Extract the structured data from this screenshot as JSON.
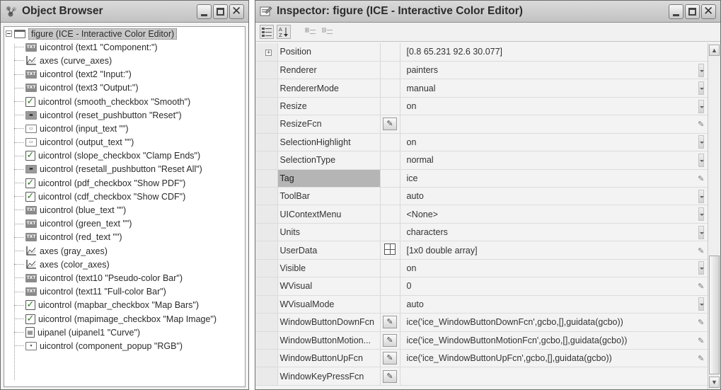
{
  "object_browser": {
    "title": "Object Browser",
    "root_label": "figure (ICE - Interactive Color Editor)",
    "items": [
      {
        "icon": "text-control-icon",
        "label": "uicontrol (text1 \"Component:\")"
      },
      {
        "icon": "axes-icon",
        "label": "axes (curve_axes)"
      },
      {
        "icon": "text-control-icon",
        "label": "uicontrol (text2 \"Input:\")"
      },
      {
        "icon": "text-control-icon",
        "label": "uicontrol (text3 \"Output:\")"
      },
      {
        "icon": "checkbox-icon",
        "label": "uicontrol (smooth_checkbox \"Smooth\")"
      },
      {
        "icon": "pushbutton-icon",
        "label": "uicontrol (reset_pushbutton \"Reset\")"
      },
      {
        "icon": "edit-text-icon",
        "label": "uicontrol (input_text \"\")"
      },
      {
        "icon": "edit-text-icon",
        "label": "uicontrol (output_text \"\")"
      },
      {
        "icon": "checkbox-icon",
        "label": "uicontrol (slope_checkbox \"Clamp Ends\")"
      },
      {
        "icon": "pushbutton-icon",
        "label": "uicontrol (resetall_pushbutton \"Reset All\")"
      },
      {
        "icon": "checkbox-icon",
        "label": "uicontrol (pdf_checkbox \"Show PDF\")"
      },
      {
        "icon": "checkbox-icon",
        "label": "uicontrol (cdf_checkbox \"Show CDF\")"
      },
      {
        "icon": "text-control-icon",
        "label": "uicontrol (blue_text \"\")"
      },
      {
        "icon": "text-control-icon",
        "label": "uicontrol (green_text \"\")"
      },
      {
        "icon": "text-control-icon",
        "label": "uicontrol (red_text \"\")"
      },
      {
        "icon": "axes-icon",
        "label": "axes (gray_axes)"
      },
      {
        "icon": "axes-icon",
        "label": "axes (color_axes)"
      },
      {
        "icon": "text-control-icon",
        "label": "uicontrol (text10 \"Pseudo-color Bar\")"
      },
      {
        "icon": "text-control-icon",
        "label": "uicontrol (text11 \"Full-color Bar\")"
      },
      {
        "icon": "checkbox-icon",
        "label": "uicontrol (mapbar_checkbox \"Map Bars\")"
      },
      {
        "icon": "checkbox-icon",
        "label": "uicontrol (mapimage_checkbox \"Map Image\")"
      },
      {
        "icon": "uipanel-icon",
        "label": "uipanel (uipanel1 \"Curve\")"
      },
      {
        "icon": "popup-icon",
        "label": "uicontrol (component_popup \"RGB\")"
      }
    ]
  },
  "inspector": {
    "title": "Inspector:  figure (ICE - Interactive Color Editor)",
    "selected_property": "Tag",
    "properties": [
      {
        "name": "Position",
        "value": "[0.8 65.231 92.6 30.077]",
        "expandable": true,
        "button": "",
        "edit": "none"
      },
      {
        "name": "Renderer",
        "value": "painters",
        "button": "",
        "edit": "dropdown"
      },
      {
        "name": "RendererMode",
        "value": "manual",
        "button": "",
        "edit": "dropdown"
      },
      {
        "name": "Resize",
        "value": "on",
        "button": "",
        "edit": "dropdown"
      },
      {
        "name": "ResizeFcn",
        "value": "",
        "button": "callback-icon",
        "edit": "pencil"
      },
      {
        "name": "SelectionHighlight",
        "value": "on",
        "button": "",
        "edit": "dropdown"
      },
      {
        "name": "SelectionType",
        "value": "normal",
        "button": "",
        "edit": "dropdown"
      },
      {
        "name": "Tag",
        "value": "ice",
        "button": "",
        "edit": "pencil"
      },
      {
        "name": "ToolBar",
        "value": "auto",
        "button": "",
        "edit": "dropdown"
      },
      {
        "name": "UIContextMenu",
        "value": "<None>",
        "button": "",
        "edit": "dropdown"
      },
      {
        "name": "Units",
        "value": "characters",
        "button": "",
        "edit": "dropdown"
      },
      {
        "name": "UserData",
        "value": "[1x0  double array]",
        "button": "array-icon",
        "edit": "pencil"
      },
      {
        "name": "Visible",
        "value": "on",
        "button": "",
        "edit": "dropdown"
      },
      {
        "name": "WVisual",
        "value": "0",
        "button": "",
        "edit": "pencil"
      },
      {
        "name": "WVisualMode",
        "value": "auto",
        "button": "",
        "edit": "dropdown"
      },
      {
        "name": "WindowButtonDownFcn",
        "value": "ice('ice_WindowButtonDownFcn',gcbo,[],guidata(gcbo))",
        "button": "callback-icon",
        "edit": "pencil"
      },
      {
        "name": "WindowButtonMotion...",
        "value": "ice('ice_WindowButtonMotionFcn',gcbo,[],guidata(gcbo))",
        "button": "callback-icon",
        "edit": "pencil"
      },
      {
        "name": "WindowButtonUpFcn",
        "value": "ice('ice_WindowButtonUpFcn',gcbo,[],guidata(gcbo))",
        "button": "callback-icon",
        "edit": "pencil"
      },
      {
        "name": "WindowKeyPressFcn",
        "value": "",
        "button": "callback-icon",
        "edit": "none"
      }
    ]
  }
}
